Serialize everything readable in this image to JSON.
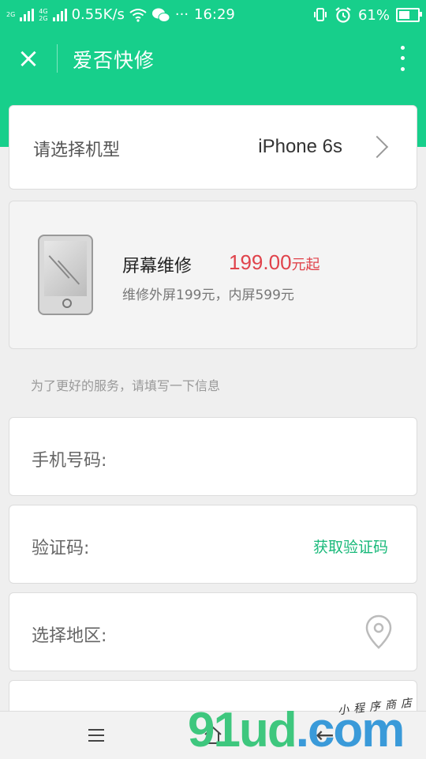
{
  "status_bar": {
    "net_top": "2G",
    "net_mid": "4G",
    "net_bottom": "2G",
    "speed": "0.55K/s",
    "more": "···",
    "time": "16:29",
    "battery": "61%"
  },
  "title_bar": {
    "close_icon": "×",
    "title": "爱否快修",
    "menu_icon": "more-vertical-icon"
  },
  "model_selector": {
    "label": "请选择机型",
    "value": "iPhone 6s"
  },
  "service": {
    "name": "屏幕维修",
    "price": "199.00",
    "price_suffix": "元起",
    "description": "维修外屏199元，内屏599元"
  },
  "hint": "为了更好的服务，请填写一下信息",
  "form": {
    "phone_label": "手机号码:",
    "code_label": "验证码:",
    "get_code": "获取验证码",
    "region_label": "选择地区:"
  },
  "nav_bar": {
    "back_icon": "←"
  },
  "watermark": {
    "brand": "91ud",
    "tld": ".com",
    "sub": "小程序商店"
  },
  "colors": {
    "accent": "#17cf8b",
    "price": "#e0434b",
    "link": "#19b97a"
  }
}
